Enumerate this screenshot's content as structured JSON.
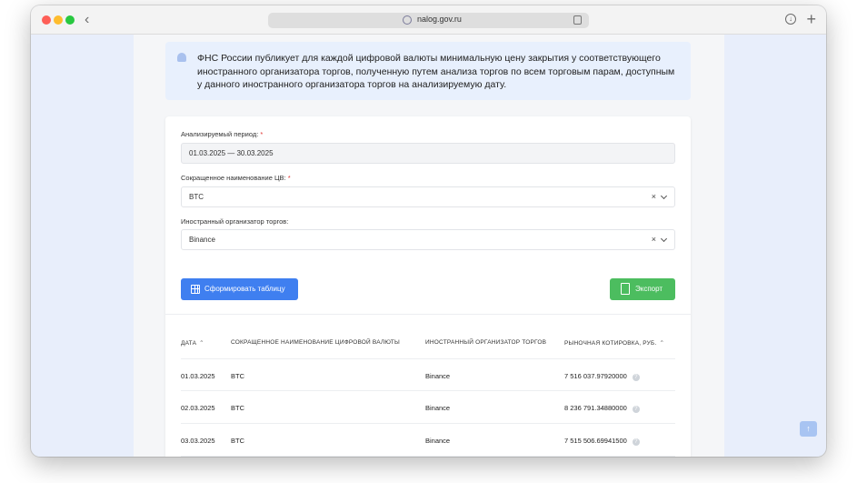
{
  "browser": {
    "url": "nalog.gov.ru"
  },
  "notice": {
    "text": "ФНС России публикует для каждой цифровой валюты минимальную цену закрытия у соответствующего иностранного организатора торгов, полученную путем анализа торгов по всем торговым парам, доступным у данного иностранного организатора торгов на анализируемую дату."
  },
  "form": {
    "period_label": "Анализируемый период:",
    "period_value": "01.03.2025 — 30.03.2025",
    "currency_label": "Сокращенное наименование ЦВ:",
    "currency_value": "BTC",
    "organizer_label": "Иностранный организатор торгов:",
    "organizer_value": "Binance",
    "required_mark": "*",
    "clear_glyph": "×"
  },
  "buttons": {
    "build_table": "Сформировать таблицу",
    "export": "Экспорт"
  },
  "table": {
    "headers": {
      "date": "ДАТА",
      "currency": "СОКРАЩЕННОЕ НАИМЕНОВАНИЕ ЦИФРОВОЙ ВАЛЮТЫ",
      "organizer": "ИНОСТРАННЫЙ ОРГАНИЗАТОР ТОРГОВ",
      "price": "РЫНОЧНАЯ КОТИРОВКА, РУБ."
    },
    "rows": [
      {
        "date": "01.03.2025",
        "currency": "BTC",
        "organizer": "Binance",
        "price": "7 516 037.97920000"
      },
      {
        "date": "02.03.2025",
        "currency": "BTC",
        "organizer": "Binance",
        "price": "8 236 791.34880000"
      },
      {
        "date": "03.03.2025",
        "currency": "BTC",
        "organizer": "Binance",
        "price": "7 515 506.69941500"
      }
    ],
    "help_glyph": "?"
  },
  "colors": {
    "primary": "#3f7ff0",
    "success": "#4cbd5f",
    "notice_bg": "#e8f0fd",
    "required": "#e0322f"
  },
  "icons": [
    "back-icon",
    "shield-icon",
    "reader-icon",
    "download-icon",
    "new-tab-icon",
    "bell-icon",
    "table-icon",
    "xls-file-icon",
    "sort-arrow-icon",
    "help-icon",
    "scroll-top-icon"
  ]
}
